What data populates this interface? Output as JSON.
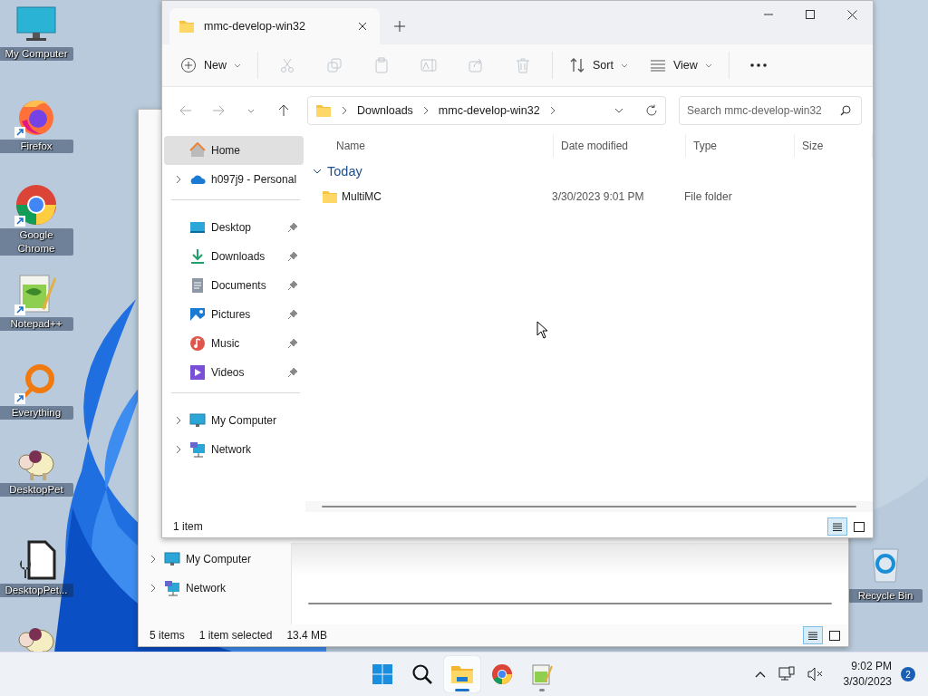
{
  "desktop": {
    "icons": [
      {
        "kind": "computer",
        "label": "My Computer"
      },
      {
        "kind": "firefox",
        "label": "Firefox",
        "shortcut": true
      },
      {
        "kind": "chrome",
        "label": "Google Chrome",
        "shortcut": true
      },
      {
        "kind": "notepad",
        "label": "Notepad++",
        "shortcut": true
      },
      {
        "kind": "everything",
        "label": "Everything",
        "shortcut": true
      },
      {
        "kind": "pet",
        "label": "DesktopPet"
      },
      {
        "kind": "settings-file",
        "label": "DesktopPet..."
      },
      {
        "kind": "pet"
      }
    ],
    "recycle_bin": {
      "label": "Recycle Bin"
    }
  },
  "back_window": {
    "nav_items": [
      {
        "kind": "computer",
        "label": "My Computer",
        "expandable": true
      },
      {
        "kind": "network",
        "label": "Network",
        "expandable": true
      }
    ],
    "status": [
      "5 items",
      "1 item selected",
      "13.4 MB"
    ],
    "views": [
      {
        "kind": "details",
        "selected": true
      },
      {
        "kind": "tiles",
        "selected": false
      }
    ]
  },
  "window": {
    "tab": {
      "title": "mmc-develop-win32"
    },
    "toolbar": [
      {
        "kind": "new",
        "label": "New",
        "disabled": false
      },
      {
        "kind": "cut",
        "disabled": true
      },
      {
        "kind": "copy",
        "disabled": true
      },
      {
        "kind": "paste",
        "disabled": true
      },
      {
        "kind": "rename",
        "disabled": true
      },
      {
        "kind": "share",
        "disabled": true
      },
      {
        "kind": "delete",
        "disabled": true
      },
      {
        "kind": "sort",
        "label": "Sort",
        "disabled": false
      },
      {
        "kind": "view",
        "label": "View",
        "disabled": false
      },
      {
        "kind": "more"
      }
    ],
    "breadcrumb": [
      "Downloads",
      "mmc-develop-win32"
    ],
    "search": {
      "placeholder": "Search mmc-develop-win32"
    },
    "nav_groups": [
      [
        {
          "kind": "home",
          "label": "Home",
          "selected": true
        },
        {
          "kind": "cloud",
          "label": "h097j9 - Personal",
          "expandable": true,
          "selected": false
        }
      ],
      [
        {
          "kind": "desktop",
          "label": "Desktop",
          "pinned": true,
          "selected": false
        },
        {
          "kind": "download",
          "label": "Downloads",
          "pinned": true,
          "selected": false
        },
        {
          "kind": "documents",
          "label": "Documents",
          "pinned": true,
          "selected": false
        },
        {
          "kind": "pictures",
          "label": "Pictures",
          "pinned": true,
          "selected": false
        },
        {
          "kind": "music",
          "label": "Music",
          "pinned": true,
          "selected": false
        },
        {
          "kind": "videos",
          "label": "Videos",
          "pinned": true,
          "selected": false
        }
      ],
      [
        {
          "kind": "computer",
          "label": "My Computer",
          "expandable": true,
          "selected": false
        },
        {
          "kind": "network",
          "label": "Network",
          "expandable": true,
          "selected": false
        }
      ]
    ],
    "table": {
      "columns": [
        "Name",
        "Date modified",
        "Type",
        "Size"
      ],
      "groups": [
        {
          "label": "Today",
          "expanded": true,
          "rows": [
            {
              "name": "MultiMC",
              "date_modified": "3/30/2023 9:01 PM",
              "type": "File folder"
            }
          ]
        }
      ]
    },
    "status": "1 item",
    "views": [
      {
        "kind": "details",
        "selected": true
      },
      {
        "kind": "tiles",
        "selected": false
      }
    ]
  },
  "taskbar": {
    "apps": [
      {
        "kind": "start",
        "active": false
      },
      {
        "kind": "search",
        "active": false
      },
      {
        "kind": "explorer",
        "active": true,
        "running": true
      },
      {
        "kind": "chrome",
        "active": false
      },
      {
        "kind": "notepad",
        "active": false,
        "running": true
      }
    ],
    "time": "9:02 PM",
    "date": "3/30/2023",
    "notifications": "2"
  }
}
